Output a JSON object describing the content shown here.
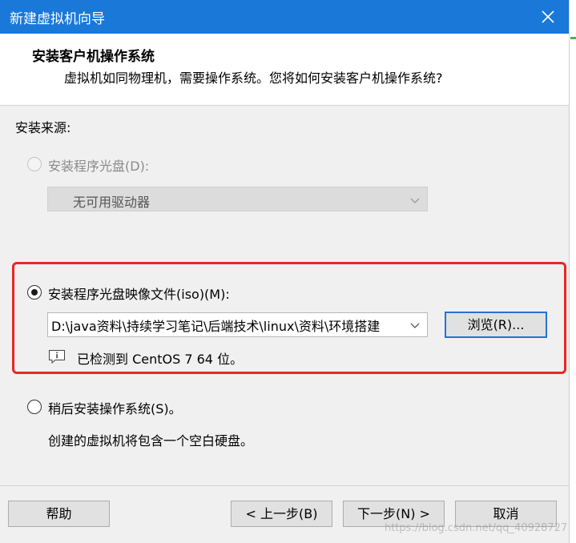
{
  "window": {
    "title": "新建虚拟机向导"
  },
  "header": {
    "title": "安装客户机操作系统",
    "subtitle": "虚拟机如同物理机，需要操作系统。您将如何安装客户机操作系统?"
  },
  "source_label": "安装来源:",
  "options": {
    "disc": {
      "label": "安装程序光盘(D):",
      "selected": false,
      "enabled": false,
      "dropdown_value": "无可用驱动器"
    },
    "iso": {
      "label": "安装程序光盘映像文件(iso)(M):",
      "selected": true,
      "path_value": "D:\\java资料\\持续学习笔记\\后端技术\\linux\\资料\\环境搭建",
      "browse_label": "浏览(R)...",
      "detect_text": "已检测到 CentOS 7 64 位。"
    },
    "later": {
      "label": "稍后安装操作系统(S)。",
      "selected": false,
      "description": "创建的虚拟机将包含一个空白硬盘。"
    }
  },
  "footer": {
    "help_label": "帮助",
    "back_label": "< 上一步(B)",
    "next_label": "下一步(N) >",
    "cancel_label": "取消"
  },
  "watermark": "https://blog.csdn.net/qq_40928727",
  "colors": {
    "titlebar": "#1a78d8",
    "highlight_border": "#ee2424",
    "focus_border": "#1f74d6"
  }
}
